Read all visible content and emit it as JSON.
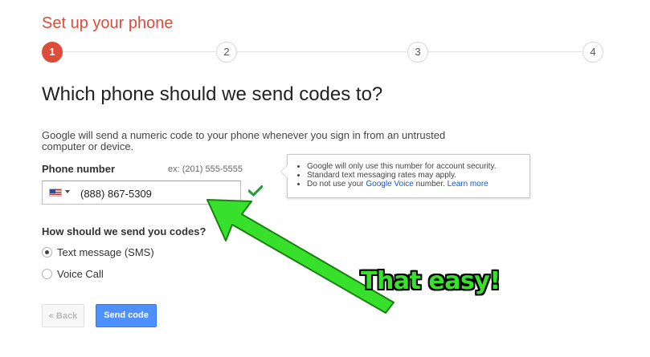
{
  "page": {
    "title": "Set up your phone",
    "heading": "Which phone should we send codes to?",
    "description": "Google will send a numeric code to your phone whenever you sign in from an untrusted computer or device."
  },
  "stepper": {
    "steps": [
      "1",
      "2",
      "3",
      "4"
    ],
    "active_step": "1",
    "active_color": "#dd4b39"
  },
  "phone": {
    "label": "Phone number",
    "example": "ex: (201) 555-5555",
    "value": "(888) 867-5309",
    "country_flag_icon": "us-flag-icon",
    "valid_icon": "checkmark-icon"
  },
  "tooltip": {
    "items": [
      "Google will only use this number for account security.",
      "Standard text messaging rates may apply."
    ],
    "item3_prefix": "Do not use your ",
    "item3_link": "Google Voice",
    "item3_suffix": " number. ",
    "learn_more": "Learn more"
  },
  "delivery": {
    "question": "How should we send you codes?",
    "options": [
      {
        "label": "Text message (SMS)",
        "selected": true
      },
      {
        "label": "Voice Call",
        "selected": false
      }
    ]
  },
  "buttons": {
    "back": "« Back",
    "send": "Send code",
    "send_color": "#4d90fe"
  },
  "annotation": {
    "text": "That easy!",
    "color": "#37e12b"
  }
}
